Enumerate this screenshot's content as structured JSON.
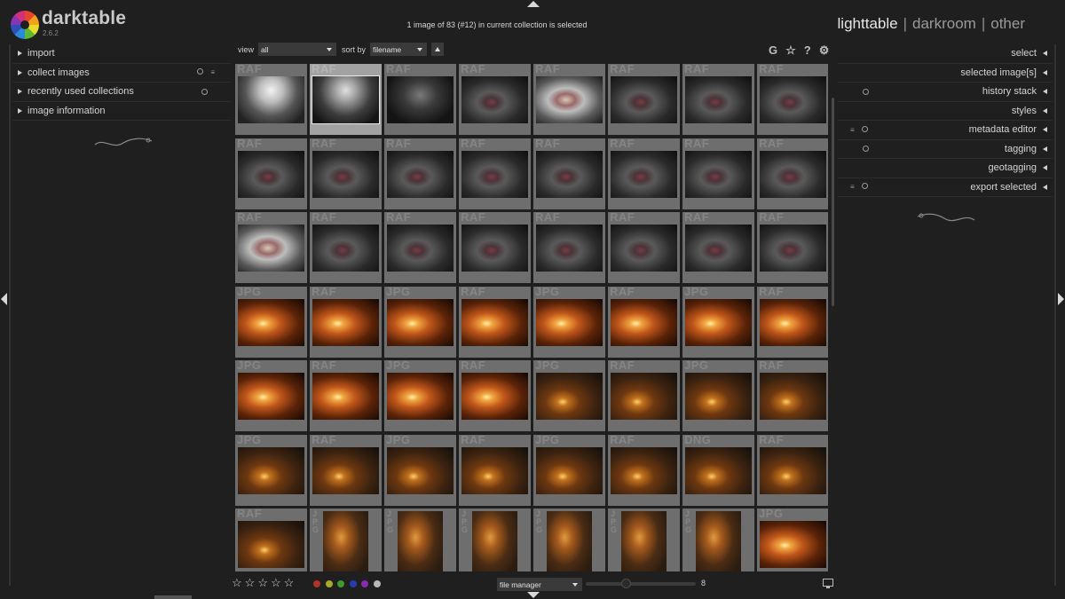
{
  "app": {
    "name": "darktable",
    "version": "2.6.2"
  },
  "status": "1 image of 83 (#12) in current collection is selected",
  "views": {
    "lighttable": "lighttable",
    "darkroom": "darkroom",
    "other": "other",
    "separator": "|"
  },
  "left_modules": [
    {
      "label": "import",
      "icons": []
    },
    {
      "label": "collect images",
      "icons": [
        "preset-icon",
        "menu-icon"
      ]
    },
    {
      "label": "recently used collections",
      "icons": [
        "preset-icon"
      ]
    },
    {
      "label": "image information",
      "icons": []
    }
  ],
  "right_modules": [
    {
      "label": "select",
      "icons": []
    },
    {
      "label": "selected image[s]",
      "icons": []
    },
    {
      "label": "history stack",
      "icons": [
        "preset-icon"
      ]
    },
    {
      "label": "styles",
      "icons": []
    },
    {
      "label": "metadata editor",
      "icons": [
        "menu-icon",
        "preset-icon"
      ]
    },
    {
      "label": "tagging",
      "icons": [
        "preset-icon"
      ]
    },
    {
      "label": "geotagging",
      "icons": []
    },
    {
      "label": "export selected",
      "icons": [
        "menu-icon",
        "preset-icon"
      ]
    }
  ],
  "toolbar": {
    "view_label": "view",
    "view_value": "all",
    "sort_label": "sort by",
    "sort_value": "filename",
    "icons": {
      "grouping": "G",
      "star": "☆",
      "help": "?",
      "settings": "⚙"
    }
  },
  "thumbnails": [
    {
      "ext": "RAF",
      "scene": "bright"
    },
    {
      "ext": "RAF",
      "scene": "bright-sel",
      "selected": true
    },
    {
      "ext": "RAF",
      "scene": "dark"
    },
    {
      "ext": "RAF",
      "scene": "baby"
    },
    {
      "ext": "RAF",
      "scene": "baby-bright"
    },
    {
      "ext": "RAF",
      "scene": "baby"
    },
    {
      "ext": "RAF",
      "scene": "baby"
    },
    {
      "ext": "RAF",
      "scene": "baby"
    },
    {
      "ext": "RAF",
      "scene": "baby"
    },
    {
      "ext": "RAF",
      "scene": "baby"
    },
    {
      "ext": "RAF",
      "scene": "baby"
    },
    {
      "ext": "RAF",
      "scene": "baby"
    },
    {
      "ext": "RAF",
      "scene": "baby"
    },
    {
      "ext": "RAF",
      "scene": "baby"
    },
    {
      "ext": "RAF",
      "scene": "baby"
    },
    {
      "ext": "RAF",
      "scene": "baby"
    },
    {
      "ext": "RAF",
      "scene": "baby-bright"
    },
    {
      "ext": "RAF",
      "scene": "baby"
    },
    {
      "ext": "RAF",
      "scene": "baby"
    },
    {
      "ext": "RAF",
      "scene": "baby"
    },
    {
      "ext": "RAF",
      "scene": "baby"
    },
    {
      "ext": "RAF",
      "scene": "baby"
    },
    {
      "ext": "RAF",
      "scene": "baby"
    },
    {
      "ext": "RAF",
      "scene": "baby"
    },
    {
      "ext": "JPG",
      "scene": "fire"
    },
    {
      "ext": "RAF",
      "scene": "fire"
    },
    {
      "ext": "JPG",
      "scene": "fire"
    },
    {
      "ext": "RAF",
      "scene": "fire"
    },
    {
      "ext": "JPG",
      "scene": "fire"
    },
    {
      "ext": "RAF",
      "scene": "fire"
    },
    {
      "ext": "JPG",
      "scene": "fire"
    },
    {
      "ext": "RAF",
      "scene": "fire"
    },
    {
      "ext": "JPG",
      "scene": "fire"
    },
    {
      "ext": "RAF",
      "scene": "fire"
    },
    {
      "ext": "JPG",
      "scene": "fire"
    },
    {
      "ext": "RAF",
      "scene": "fire"
    },
    {
      "ext": "JPG",
      "scene": "fire-dim"
    },
    {
      "ext": "RAF",
      "scene": "fire-dim"
    },
    {
      "ext": "JPG",
      "scene": "fire-dim"
    },
    {
      "ext": "RAF",
      "scene": "fire-dim"
    },
    {
      "ext": "JPG",
      "scene": "fire-dim"
    },
    {
      "ext": "RAF",
      "scene": "fire-dim"
    },
    {
      "ext": "JPG",
      "scene": "fire-dim"
    },
    {
      "ext": "RAF",
      "scene": "fire-dim"
    },
    {
      "ext": "JPG",
      "scene": "fire-dim"
    },
    {
      "ext": "RAF",
      "scene": "fire-dim"
    },
    {
      "ext": "DNG",
      "scene": "fire-dim"
    },
    {
      "ext": "RAF",
      "scene": "fire-dim"
    },
    {
      "ext": "RAF",
      "scene": "fire-dim"
    },
    {
      "ext": "JPG",
      "scene": "wood",
      "portrait": true
    },
    {
      "ext": "JPG",
      "scene": "wood",
      "portrait": true
    },
    {
      "ext": "JPG",
      "scene": "wood",
      "portrait": true
    },
    {
      "ext": "JPG",
      "scene": "wood",
      "portrait": true
    },
    {
      "ext": "JPG",
      "scene": "wood",
      "portrait": true
    },
    {
      "ext": "JPG",
      "scene": "wood",
      "portrait": true
    },
    {
      "ext": "JPG",
      "scene": "fire"
    }
  ],
  "footer": {
    "stars": [
      "☆",
      "☆",
      "☆",
      "☆",
      "☆"
    ],
    "color_labels": [
      "#b0342a",
      "#a8a82a",
      "#3e9a2e",
      "#2a3ab0",
      "#8a2ab0",
      "#b8b8b8"
    ],
    "layout_value": "file manager",
    "zoom_value": "8"
  },
  "colors": {
    "background": "#1f1f1f",
    "thumb": "#6e6e6e",
    "thumb_selected": "#a2a2a2",
    "text": "#cfcfcf"
  }
}
